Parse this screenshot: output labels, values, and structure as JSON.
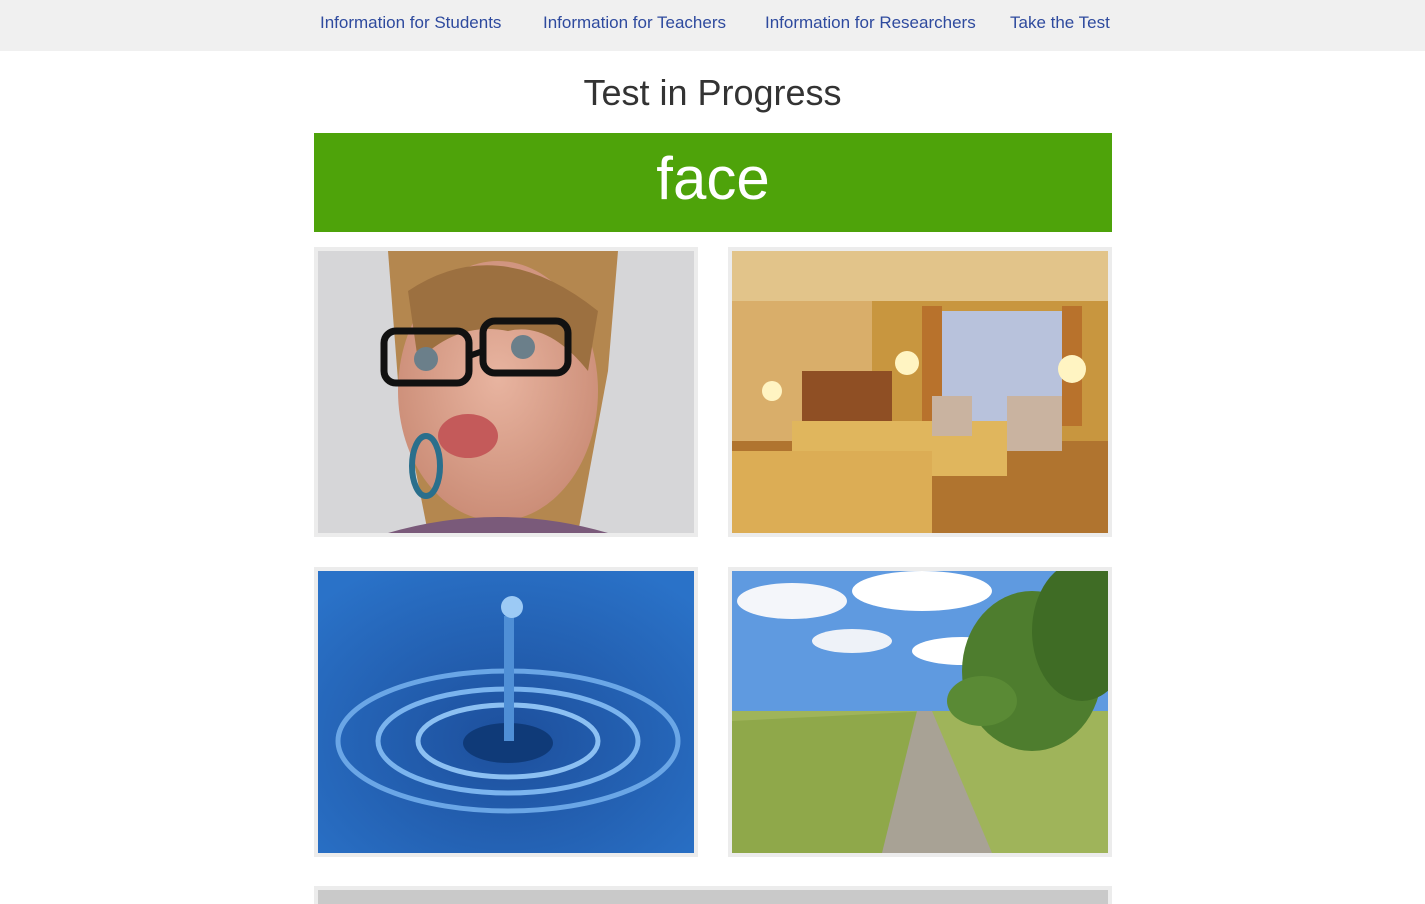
{
  "nav": {
    "students": "Information for Students",
    "teachers": "Information for Teachers",
    "researchers": "Information for Researchers",
    "test": "Take the Test"
  },
  "page_title": "Test in Progress",
  "target_word": "face",
  "colors": {
    "banner": "#4ea30a",
    "nav_link": "#2e4a9e",
    "nav_bg": "#f0f0f0"
  },
  "choices": [
    {
      "id": "c1",
      "depicts": "face"
    },
    {
      "id": "c2",
      "depicts": "hotel room"
    },
    {
      "id": "c3",
      "depicts": "water drop"
    },
    {
      "id": "c4",
      "depicts": "country road"
    }
  ]
}
